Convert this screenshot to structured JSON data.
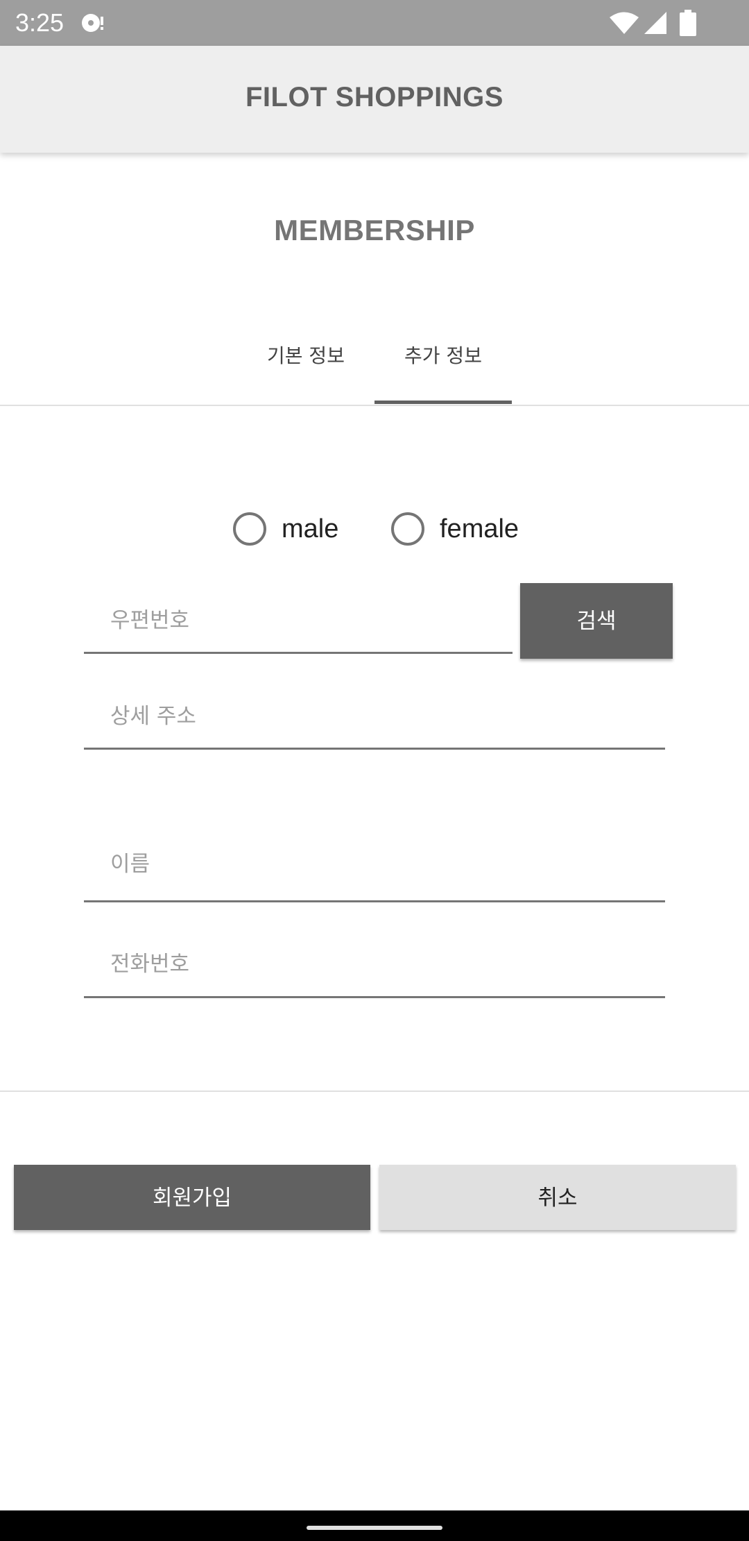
{
  "status_bar": {
    "time": "3:25",
    "icons": [
      "notification-icon",
      "wifi-icon",
      "signal-icon",
      "battery-icon"
    ]
  },
  "app_bar": {
    "title": "FILOT SHOPPINGS"
  },
  "page": {
    "section_title": "MEMBERSHIP"
  },
  "tabs": [
    {
      "label": "기본 정보",
      "selected": false
    },
    {
      "label": "추가 정보",
      "selected": true
    }
  ],
  "gender": {
    "options": [
      {
        "label": "male",
        "checked": false
      },
      {
        "label": "female",
        "checked": false
      }
    ]
  },
  "form": {
    "postal_code": {
      "value": "",
      "placeholder": "우편번호"
    },
    "search_label": "검색",
    "address_detail": {
      "value": "",
      "placeholder": "상세 주소"
    },
    "name": {
      "value": "",
      "placeholder": "이름"
    },
    "phone": {
      "value": "",
      "placeholder": "전화번호"
    }
  },
  "actions": {
    "join_label": "회원가입",
    "cancel_label": "취소"
  },
  "colors": {
    "status_bar": "#9e9e9e",
    "app_bar": "#eeeeee",
    "primary_button": "#616161",
    "secondary_button": "#e0e0e0",
    "title_text": "#616161"
  }
}
